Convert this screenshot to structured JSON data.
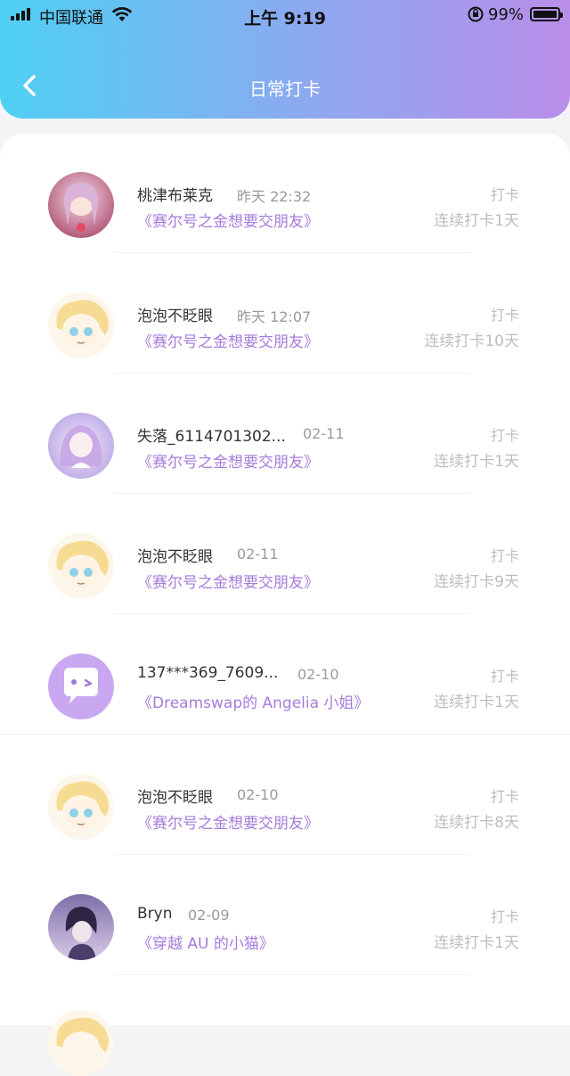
{
  "status_bar": {
    "carrier": "中国联通",
    "time": "上午 9:19",
    "battery": "99%"
  },
  "header": {
    "title": "日常打卡"
  },
  "entries": [
    {
      "name": "桃津布莱克",
      "date": "昨天 22:32",
      "book": "《赛尔号之金想要交朋友》",
      "punch_label": "打卡",
      "streak": "连续打卡1天"
    },
    {
      "name": "泡泡不眨眼",
      "date": "昨天 12:07",
      "book": "《赛尔号之金想要交朋友》",
      "punch_label": "打卡",
      "streak": "连续打卡10天"
    },
    {
      "name": "失落_6114701302...",
      "date": "02-11",
      "book": "《赛尔号之金想要交朋友》",
      "punch_label": "打卡",
      "streak": "连续打卡1天"
    },
    {
      "name": "泡泡不眨眼",
      "date": "02-11",
      "book": "《赛尔号之金想要交朋友》",
      "punch_label": "打卡",
      "streak": "连续打卡9天"
    },
    {
      "name": "137***369_7609...",
      "date": "02-10",
      "book": "《Dreamswap的 Angelia 小姐》",
      "punch_label": "打卡",
      "streak": "连续打卡1天"
    },
    {
      "name": "泡泡不眨眼",
      "date": "02-10",
      "book": "《赛尔号之金想要交朋友》",
      "punch_label": "打卡",
      "streak": "连续打卡8天"
    },
    {
      "name": "Bryn",
      "date": "02-09",
      "book": "《穿越 AU 的小猫》",
      "punch_label": "打卡",
      "streak": "连续打卡1天"
    }
  ],
  "colors": {
    "accent_text": "#a57cdc",
    "header_gradient_start": "#4fd0f5",
    "header_gradient_end": "#b98ee9"
  },
  "icons": {
    "back": "chevron-left-icon",
    "wifi": "wifi-icon",
    "signal": "signal-bars-icon",
    "battery": "battery-icon",
    "orientation_lock": "orientation-lock-icon",
    "default_avatar": "chat-bubble-wink-icon"
  }
}
